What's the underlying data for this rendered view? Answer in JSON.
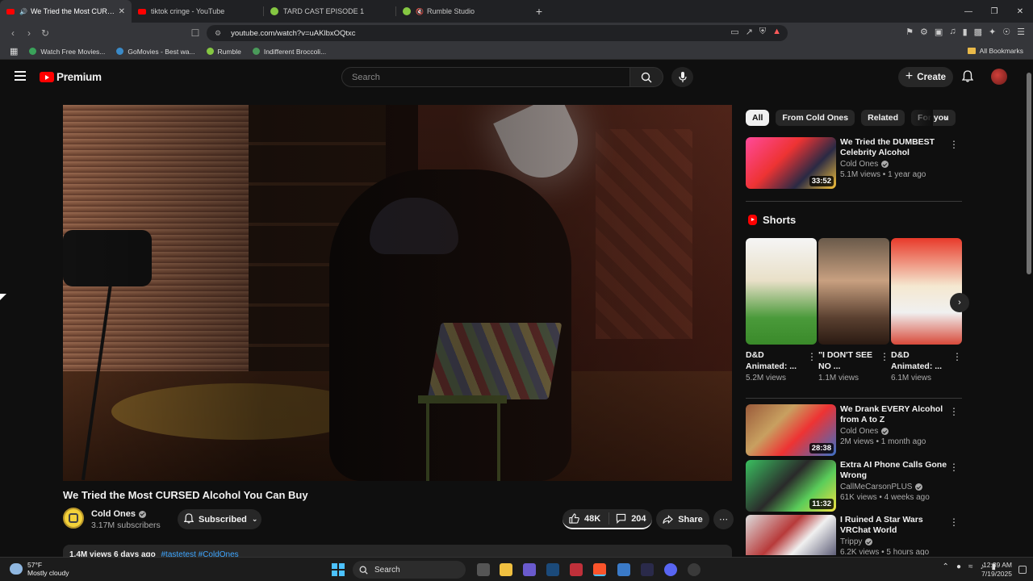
{
  "browser": {
    "tabs": [
      {
        "title": "We Tried the Most CURSED Al...",
        "favicon": "youtube",
        "active": true,
        "playing": true
      },
      {
        "title": "tiktok cringe - YouTube",
        "favicon": "youtube",
        "active": false
      },
      {
        "title": "TARD CAST EPISODE 1",
        "favicon": "rumble",
        "active": false
      },
      {
        "title": "Rumble Studio",
        "favicon": "rumble",
        "active": false
      }
    ],
    "url": "youtube.com/watch?v=uAKlbxOQtxc",
    "bookmarks": [
      {
        "label": "Watch Free Movies...",
        "color": "#3aa35a"
      },
      {
        "label": "GoMovies - Best wa...",
        "color": "#3a8ac8"
      },
      {
        "label": "Rumble",
        "color": "#85c742"
      },
      {
        "label": "Indifferent Broccoli...",
        "color": "#4a9a5a"
      }
    ],
    "all_bookmarks": "All Bookmarks"
  },
  "yt": {
    "logo_text": "Premium",
    "search_placeholder": "Search",
    "create_label": "Create",
    "accent": "#ff0000"
  },
  "video": {
    "title": "We Tried the Most CURSED Alcohol You Can Buy",
    "channel": "Cold Ones",
    "subscribers": "3.17M subscribers",
    "subscribed_label": "Subscribed",
    "likes": "48K",
    "comments": "204",
    "share_label": "Share",
    "views_date": "1.4M views  6 days ago",
    "hashtags": "#tastetest #ColdOnes"
  },
  "chips": [
    "All",
    "From Cold Ones",
    "Related",
    "For you"
  ],
  "recs": [
    {
      "title": "We Tried the DUMBEST Celebrity Alcohol",
      "channel": "Cold Ones",
      "meta": "5.1M views • 1 year ago",
      "duration": "33:52"
    },
    {
      "title": "We Drank EVERY Alcohol from A to Z",
      "channel": "Cold Ones",
      "meta": "2M views • 1 month ago",
      "duration": "28:38"
    },
    {
      "title": "Extra AI Phone Calls Gone Wrong",
      "channel": "CallMeCarsonPLUS",
      "meta": "61K views • 4 weeks ago",
      "duration": "11:32"
    },
    {
      "title": "I Ruined A Star Wars VRChat World",
      "channel": "Trippy",
      "meta": "6.2K views • 5 hours ago",
      "duration": ""
    }
  ],
  "shorts": {
    "title": "Shorts",
    "items": [
      {
        "title": "D&D Animated: ...",
        "views": "5.2M views"
      },
      {
        "title": "\"I DON'T SEE NO ...",
        "views": "1.1M views"
      },
      {
        "title": "D&D Animated: ...",
        "views": "6.1M views"
      }
    ]
  },
  "taskbar": {
    "temp": "57°F",
    "weather": "Mostly cloudy",
    "search": "Search",
    "time": "12:39 AM",
    "date": "7/19/2025"
  }
}
